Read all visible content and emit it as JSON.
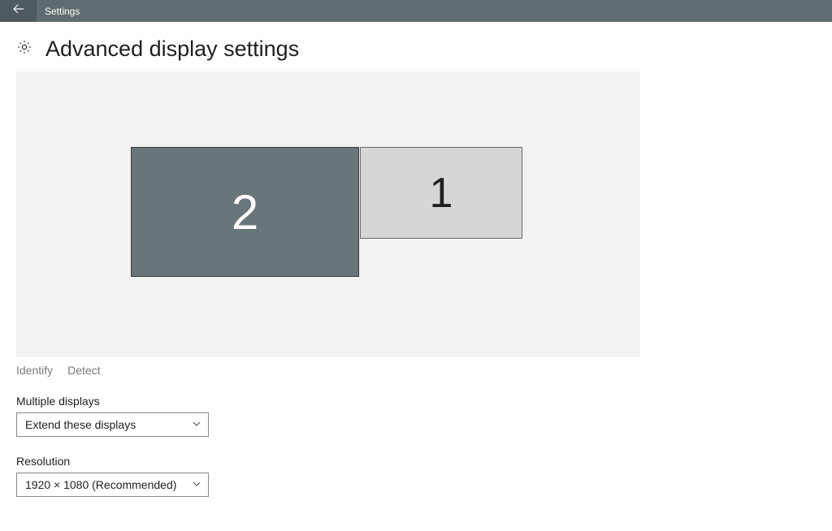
{
  "titlebar": {
    "app_name": "Settings"
  },
  "header": {
    "title": "Advanced display settings"
  },
  "monitors": {
    "secondary_label": "2",
    "primary_label": "1"
  },
  "links": {
    "identify": "Identify",
    "detect": "Detect"
  },
  "multiple_displays": {
    "label": "Multiple displays",
    "selected": "Extend these displays"
  },
  "resolution": {
    "label": "Resolution",
    "selected": "1920 × 1080 (Recommended)"
  }
}
